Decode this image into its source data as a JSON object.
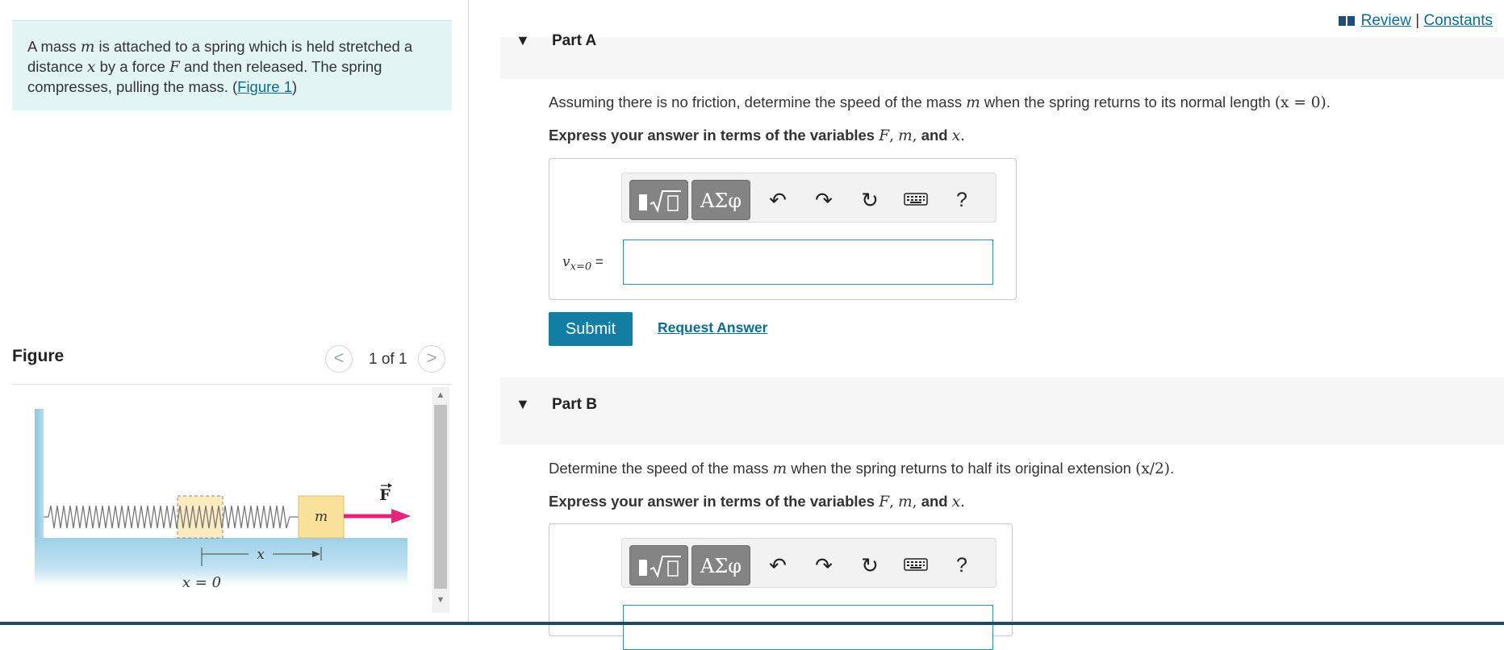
{
  "problem": {
    "text_1": "A mass ",
    "m": "m",
    "text_2": " is attached to a spring which is held stretched a distance ",
    "x": "x",
    "text_3": " by a force ",
    "F": "F",
    "text_4": " and then released. The spring compresses, pulling the mass. (",
    "figure_link": "Figure 1",
    "text_5": ")"
  },
  "figure": {
    "title": "Figure",
    "counter": "1 of 1",
    "prev_icon": "<",
    "next_icon": ">",
    "mass_label": "m",
    "force_label": "F",
    "x_label": "x",
    "origin_label": "x = 0"
  },
  "top_links": {
    "review": "Review",
    "separator": "|",
    "constants": "Constants"
  },
  "part_a": {
    "title": "Part A",
    "question_prefix": "Assuming there is no friction, determine the speed of the mass ",
    "question_var": "m",
    "question_suffix": " when the spring returns to its normal length ",
    "question_cond": "(x = 0)",
    "question_end": ".",
    "instruction": "Express your answer in terms of the variables ",
    "var_F": "F",
    "var_m": "m",
    "var_x": "x",
    "comma": ",",
    "and": "and",
    "period": ".",
    "answer_label": "v",
    "answer_sub": "x=0",
    "answer_eq": "=",
    "submit": "Submit",
    "request_answer": "Request Answer"
  },
  "part_b": {
    "title": "Part B",
    "question_prefix": "Determine the speed of the mass ",
    "question_var": "m",
    "question_suffix": " when the spring returns to half its original extension ",
    "question_cond": "(x/2)",
    "question_end": ".",
    "instruction": "Express your answer in terms of the variables ",
    "var_F": "F",
    "var_m": "m",
    "var_x": "x",
    "comma": ",",
    "and": "and",
    "period": "."
  },
  "toolbar": {
    "templates_icon": "template-radical-icon",
    "greek": "ΑΣφ",
    "undo_icon": "undo-icon",
    "redo_icon": "redo-icon",
    "reset_icon": "reset-icon",
    "keyboard_icon": "keyboard-icon",
    "help": "?"
  },
  "colors": {
    "accent": "#137ea3",
    "link": "#0a6e94",
    "problem_bg": "#e3f4f4",
    "force_arrow": "#e8237c",
    "mass_block": "#fbe29a"
  }
}
